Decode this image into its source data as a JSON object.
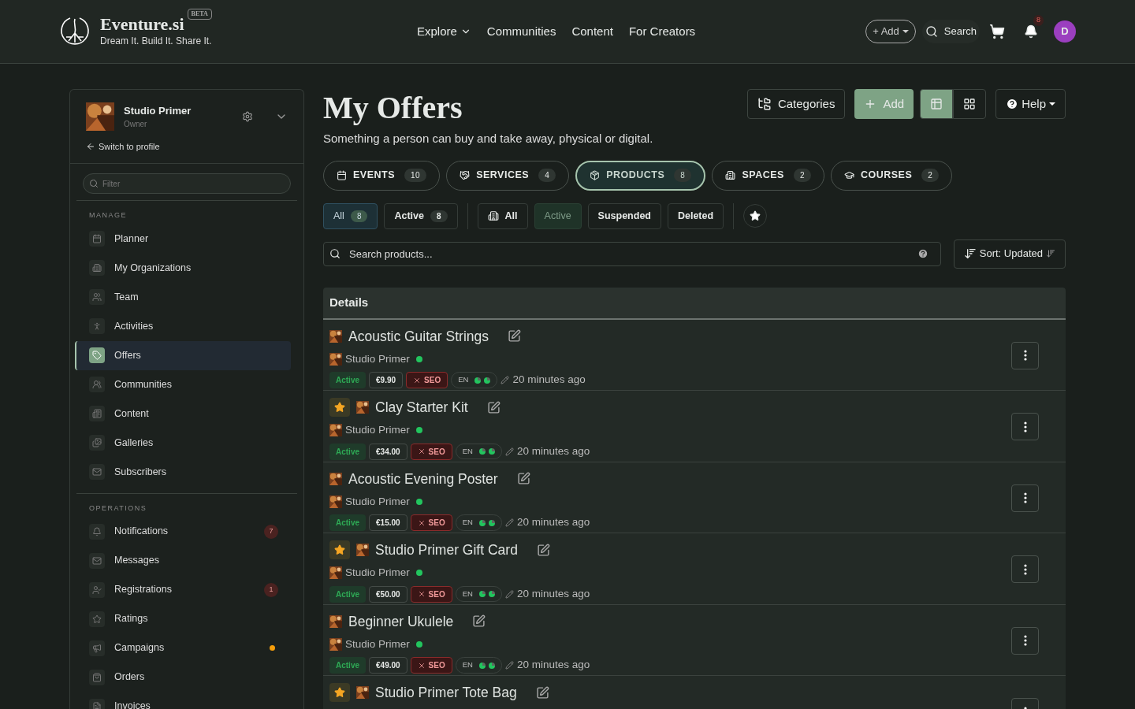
{
  "header": {
    "brand": "Eventure.si",
    "beta": "BETA",
    "tagline": "Dream It. Build It. Share It.",
    "nav": [
      {
        "label": "Explore",
        "dropdown": true
      },
      {
        "label": "Communities",
        "dropdown": false
      },
      {
        "label": "Content",
        "dropdown": false
      },
      {
        "label": "For Creators",
        "dropdown": false
      }
    ],
    "add_button": "+ Add",
    "search": "Search",
    "notification_count": "8",
    "avatar": "D"
  },
  "sidebar": {
    "org_name": "Studio Primer",
    "role": "Owner",
    "switch_link": "Switch to profile",
    "filter_placeholder": "Filter",
    "sections": [
      {
        "title": "MANAGE",
        "items": [
          {
            "label": "Planner",
            "selected": false
          },
          {
            "label": "My Organizations",
            "selected": false
          },
          {
            "label": "Team",
            "selected": false
          },
          {
            "label": "Activities",
            "selected": false
          },
          {
            "label": "Offers",
            "selected": true
          },
          {
            "label": "Communities",
            "selected": false
          },
          {
            "label": "Content",
            "selected": false
          },
          {
            "label": "Galleries",
            "selected": false
          },
          {
            "label": "Subscribers",
            "selected": false
          }
        ]
      },
      {
        "title": "OPERATIONS",
        "items": [
          {
            "label": "Notifications",
            "selected": false,
            "badge": "7"
          },
          {
            "label": "Messages",
            "selected": false
          },
          {
            "label": "Registrations",
            "selected": false,
            "badge": "1"
          },
          {
            "label": "Ratings",
            "selected": false
          },
          {
            "label": "Campaigns",
            "selected": false,
            "color": "#f59e0b"
          },
          {
            "label": "Orders",
            "selected": false
          },
          {
            "label": "Invoices",
            "selected": false
          }
        ]
      }
    ]
  },
  "main": {
    "title": "My Offers",
    "subtitle": "Something a person can buy and take away, physical or digital.",
    "toolbar": {
      "categories": "Categories",
      "add": "Add",
      "views": [
        {
          "selected": true
        },
        {
          "selected": false
        }
      ],
      "help": "Help"
    },
    "type_tabs": [
      {
        "label": "EVENTS",
        "count": "10",
        "selected": false
      },
      {
        "label": "SERVICES",
        "count": "4",
        "selected": false
      },
      {
        "label": "PRODUCTS",
        "count": "8",
        "selected": true
      },
      {
        "label": "SPACES",
        "count": "2",
        "selected": false
      },
      {
        "label": "COURSES",
        "count": "2",
        "selected": false
      }
    ],
    "scope_filters": [
      {
        "label": "All",
        "count": "8",
        "selected": true
      },
      {
        "label": "Active",
        "count": "8",
        "selected": false
      }
    ],
    "status_filters": [
      {
        "label": "All",
        "selected": false,
        "icon": true
      },
      {
        "label": "Active",
        "selected": true
      },
      {
        "label": "Suspended",
        "selected": false
      },
      {
        "label": "Deleted",
        "selected": false
      }
    ],
    "search_placeholder": "Search products...",
    "sort": "Sort: Updated",
    "table": {
      "header": "Details",
      "rows": [
        {
          "title": "Acoustic Guitar Strings",
          "favorite": false,
          "org": "Studio Primer",
          "status": "Active",
          "price": "€9.90",
          "seo": "SEO",
          "lang": "EN",
          "updated": "20 minutes ago"
        },
        {
          "title": "Clay Starter Kit",
          "favorite": true,
          "org": "Studio Primer",
          "status": "Active",
          "price": "€34.00",
          "seo": "SEO",
          "lang": "EN",
          "updated": "20 minutes ago"
        },
        {
          "title": "Acoustic Evening Poster",
          "favorite": false,
          "org": "Studio Primer",
          "status": "Active",
          "price": "€15.00",
          "seo": "SEO",
          "lang": "EN",
          "updated": "20 minutes ago"
        },
        {
          "title": "Studio Primer Gift Card",
          "favorite": true,
          "org": "Studio Primer",
          "status": "Active",
          "price": "€50.00",
          "seo": "SEO",
          "lang": "EN",
          "updated": "20 minutes ago"
        },
        {
          "title": "Beginner Ukulele",
          "favorite": false,
          "org": "Studio Primer",
          "status": "Active",
          "price": "€49.00",
          "seo": "SEO",
          "lang": "EN",
          "updated": "20 minutes ago"
        },
        {
          "title": "Studio Primer Tote Bag",
          "favorite": true
        }
      ]
    }
  }
}
